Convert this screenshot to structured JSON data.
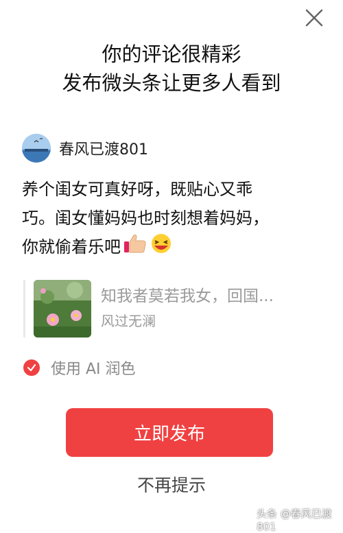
{
  "dialog": {
    "close_icon": "close-icon",
    "headline_line1": "你的评论很精彩",
    "headline_line2": "发布微头条让更多人看到"
  },
  "author": {
    "name": "春风已渡801",
    "avatar": "avatar-image"
  },
  "comment": {
    "line1": "养个闺女可真好呀，既贴心又乖",
    "line2": "巧。闺女懂妈妈也时刻想着妈妈，",
    "line3": "你就偷着乐吧",
    "emoji1": "thumbs-up-emoji",
    "emoji2": "laughing-emoji"
  },
  "quote": {
    "title": "知我者莫若我女，回国...",
    "author": "风过无澜",
    "thumb": "flower-photo-thumbnail"
  },
  "ai_polish": {
    "label": "使用 AI 润色",
    "checked": true,
    "check_color": "#f04142"
  },
  "actions": {
    "publish_label": "立即发布",
    "dismiss_label": "不再提示",
    "accent_color": "#f04142"
  },
  "watermark": "头条 @春风已渡801"
}
